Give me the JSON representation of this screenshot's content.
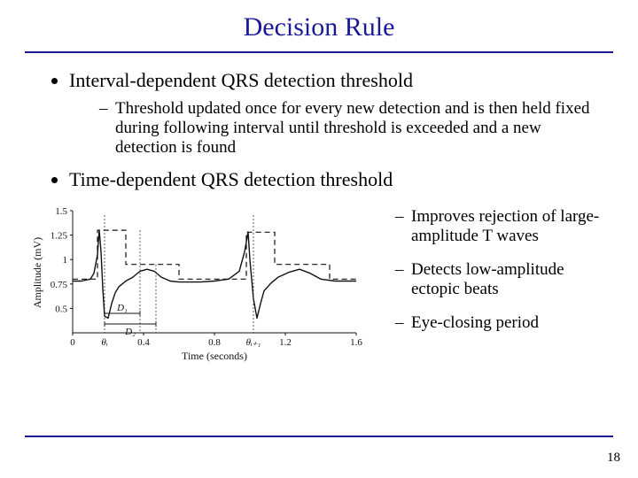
{
  "title": "Decision Rule",
  "bullets": {
    "a": {
      "text": "Interval-dependent QRS detection threshold",
      "sub1": "Threshold updated once for every new detection and is then held fixed during following interval until threshold is exceeded and a new detection is found"
    },
    "b": {
      "text": "Time-dependent QRS detection threshold",
      "sub1": "Improves rejection of large-amplitude T waves",
      "sub2": "Detects low-amplitude ectopic beats",
      "sub3": " Eye-closing period"
    }
  },
  "page_number": "18",
  "chart_data": {
    "type": "line",
    "xlabel": "Time (seconds)",
    "ylabel": "Amplitude (mV)",
    "xlim": [
      0,
      1.6
    ],
    "ylim": [
      0.25,
      1.5
    ],
    "xticks": [
      0,
      0.4,
      0.8,
      1.2,
      1.6
    ],
    "yticks": [
      0.5,
      0.75,
      1,
      1.25,
      1.5
    ],
    "annotations": {
      "theta_i": "θᵢ",
      "theta_i1": "θᵢ₊₁",
      "D1": "D₁",
      "D2": "D₂"
    },
    "markers": {
      "theta_i_x": 0.18,
      "theta_i1_x": 1.02,
      "D1_end_x": 0.38,
      "D2_end_x": 0.47
    },
    "series": [
      {
        "name": "ecg",
        "style": "solid",
        "x": [
          0.0,
          0.05,
          0.1,
          0.12,
          0.14,
          0.15,
          0.16,
          0.17,
          0.18,
          0.2,
          0.22,
          0.24,
          0.26,
          0.3,
          0.34,
          0.38,
          0.42,
          0.46,
          0.5,
          0.55,
          0.6,
          0.66,
          0.72,
          0.8,
          0.88,
          0.94,
          0.97,
          0.99,
          1.0,
          1.02,
          1.04,
          1.06,
          1.08,
          1.12,
          1.16,
          1.22,
          1.28,
          1.34,
          1.4,
          1.48,
          1.56,
          1.6
        ],
        "y": [
          0.78,
          0.78,
          0.8,
          0.86,
          1.05,
          1.3,
          1.08,
          0.7,
          0.42,
          0.4,
          0.55,
          0.66,
          0.72,
          0.78,
          0.82,
          0.88,
          0.9,
          0.88,
          0.82,
          0.78,
          0.77,
          0.77,
          0.77,
          0.78,
          0.8,
          0.88,
          1.08,
          1.28,
          1.0,
          0.6,
          0.4,
          0.55,
          0.68,
          0.76,
          0.82,
          0.87,
          0.9,
          0.86,
          0.8,
          0.78,
          0.78,
          0.78
        ]
      },
      {
        "name": "threshold",
        "style": "dashed",
        "x": [
          0.0,
          0.14,
          0.14,
          0.3,
          0.3,
          0.6,
          0.6,
          0.98,
          0.98,
          1.14,
          1.14,
          1.45,
          1.45,
          1.6
        ],
        "y": [
          0.8,
          0.8,
          1.3,
          1.3,
          0.95,
          0.95,
          0.8,
          0.8,
          1.28,
          1.28,
          0.95,
          0.95,
          0.8,
          0.8
        ]
      }
    ]
  }
}
